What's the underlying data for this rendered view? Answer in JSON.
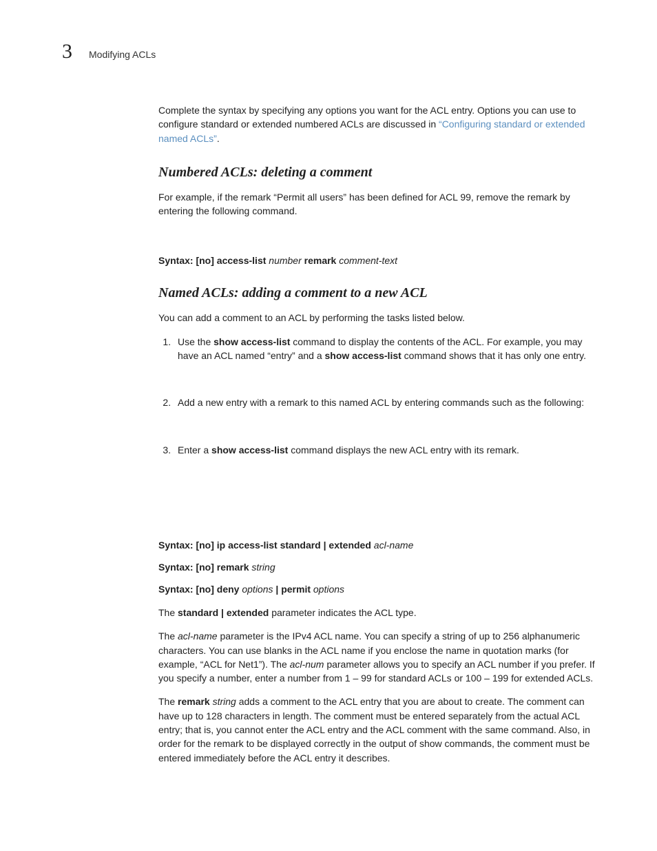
{
  "header": {
    "chapter_number": "3",
    "title": "Modifying ACLs"
  },
  "intro": {
    "text_before_link": "Complete the syntax by specifying any options you want for the ACL entry. Options you can use to configure standard or extended numbered ACLs are discussed in ",
    "link_text": "“Configuring standard or extended named ACLs”",
    "text_after_link": "."
  },
  "section1": {
    "heading": "Numbered ACLs: deleting a comment",
    "para": "For example, if the remark “Permit all users” has been defined for ACL 99, remove the remark by entering the following command.",
    "syntax": {
      "prefix": "Syntax:  [no] access-list ",
      "ital1": "number",
      "mid": " remark ",
      "ital2": "comment-text"
    }
  },
  "section2": {
    "heading": "Named ACLs: adding a comment to a new ACL",
    "intro": "You can add a comment to an ACL by performing the tasks listed below.",
    "step1": {
      "t1": "Use the ",
      "b1": "show access-list",
      "t2": " command to display the contents of the ACL. For example, you may have an ACL named “entry” and a ",
      "b2": "show access-list",
      "t3": " command shows that it has only one entry."
    },
    "step2": "Add a new entry with a remark to this named ACL by entering commands such as the following:",
    "step3": {
      "t1": "Enter a ",
      "b1": "show access-list",
      "t2": " command displays the new ACL entry with its remark."
    }
  },
  "syntax_block": {
    "l1": {
      "b": "Syntax:  [no] ip access-list standard | extended ",
      "i": "acl-name"
    },
    "l2": {
      "b": "Syntax:  [no] remark ",
      "i": "string"
    },
    "l3": {
      "b1": "Syntax:  [no] deny ",
      "i1": "options",
      "b2": " | permit ",
      "i2": "options"
    }
  },
  "explain": {
    "p1": {
      "t1": "The ",
      "b1": "standard | extended",
      "t2": " parameter indicates the ACL type."
    },
    "p2": {
      "t1": "The ",
      "i1": "acl-name",
      "t2": " parameter is the IPv4 ACL name. You can specify a string of up to 256 alphanumeric characters. You can use blanks in the ACL name if you enclose the name in quotation marks (for example, “ACL for Net1”). The ",
      "i2": "acl-num",
      "t3": " parameter allows you to specify an ACL number if you prefer. If you specify a number, enter a number from 1 – 99 for standard ACLs or 100 – 199 for extended ACLs."
    },
    "p3": {
      "t1": "The ",
      "b1": "remark ",
      "i1": "string",
      "t2": " adds a comment to the ACL entry that you are about to create. The comment can have up to 128 characters in length. The comment must be entered separately from the actual ACL entry; that is, you cannot enter the ACL entry and the ACL comment with the same command. Also, in order for the remark to be displayed correctly in the output of show commands, the comment must be entered immediately before the ACL entry it describes."
    }
  }
}
